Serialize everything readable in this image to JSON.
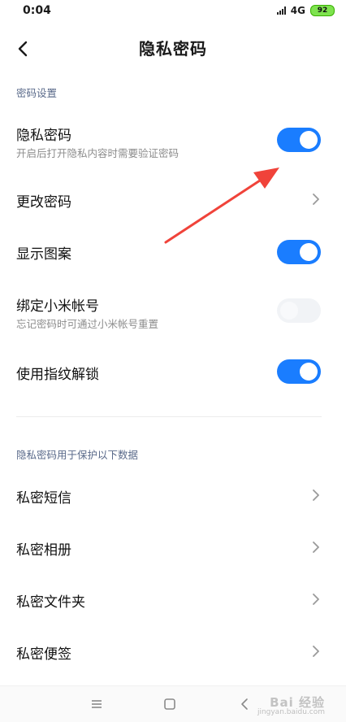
{
  "status_bar": {
    "time": "0:04",
    "network": "4G",
    "battery": "92"
  },
  "header": {
    "title": "隐私密码"
  },
  "section_password": {
    "header": "密码设置",
    "items": [
      {
        "label": "隐私密码",
        "sub": "开启后打开隐私内容时需要验证密码",
        "control": "toggle",
        "state": "on"
      },
      {
        "label": "更改密码",
        "control": "chevron"
      },
      {
        "label": "显示图案",
        "control": "toggle",
        "state": "on"
      },
      {
        "label": "绑定小米帐号",
        "sub": "忘记密码时可通过小米帐号重置",
        "control": "toggle",
        "state": "disabled"
      },
      {
        "label": "使用指纹解锁",
        "control": "toggle",
        "state": "on"
      }
    ]
  },
  "section_protect": {
    "header": "隐私密码用于保护以下数据",
    "items": [
      {
        "label": "私密短信",
        "control": "chevron"
      },
      {
        "label": "私密相册",
        "control": "chevron"
      },
      {
        "label": "私密文件夹",
        "control": "chevron"
      },
      {
        "label": "私密便签",
        "control": "chevron"
      }
    ]
  },
  "watermark": {
    "brand": "Bai 经验",
    "sub": "jingyan.baidu.com"
  },
  "colors": {
    "toggle_on": "#1a7dff",
    "toggle_disabled": "#f1f3f6",
    "annotation_arrow": "#f0433a",
    "section_header": "#5a6a8a"
  }
}
